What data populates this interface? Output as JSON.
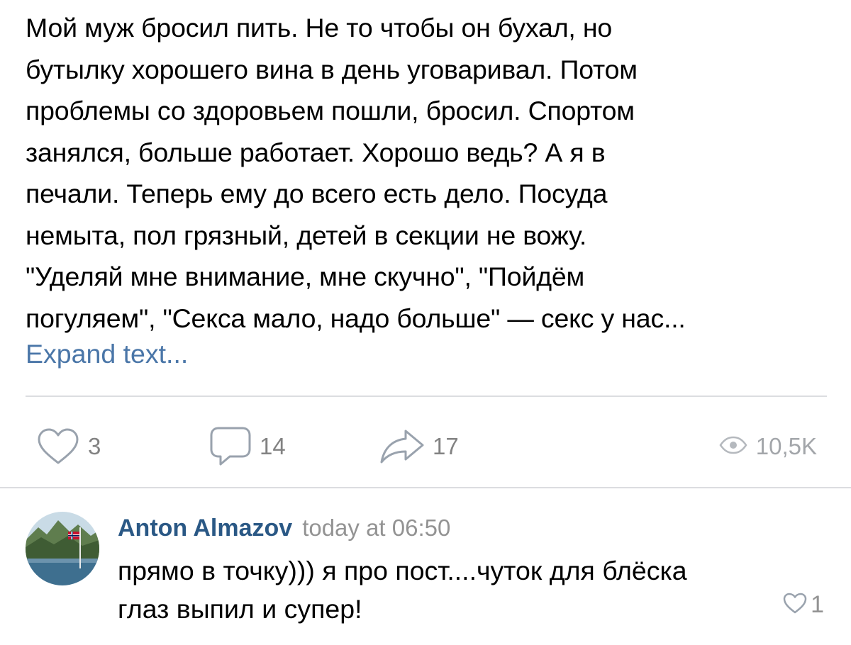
{
  "post": {
    "text_lines": [
      "Мой муж бросил пить. Не то чтобы он бухал, но",
      "бутылку хорошего вина в день уговаривал. Потом",
      "проблемы со здоровьем пошли, бросил. Спортом",
      "занялся, больше работает. Хорошо ведь? А я в",
      "печали. Теперь ему до всего есть дело. Посуда",
      "немыта, пол грязный, детей в секции не вожу.",
      "\"Уделяй мне внимание, мне скучно\", \"Пойдём",
      "погуляем\", \"Секса мало, надо больше\" — секс у нас..."
    ],
    "expand_label": "Expand text..."
  },
  "actions": {
    "likes": "3",
    "comments": "14",
    "shares": "17",
    "views": "10,5K"
  },
  "icons": {
    "like": "heart-outline-icon",
    "comment": "speech-bubble-icon",
    "share": "share-arrow-icon",
    "views": "eye-icon",
    "comment_like": "heart-outline-icon"
  },
  "comment": {
    "author": "Anton Almazov",
    "timestamp": "today at 06:50",
    "text_lines": [
      "прямо в точку))) я про пост....чуток для блёска",
      "глаз выпил и супер!"
    ],
    "likes": "1"
  },
  "colors": {
    "link": "#4a76a8",
    "author": "#2a5885",
    "muted": "#828282",
    "divider": "#dcdde0"
  }
}
